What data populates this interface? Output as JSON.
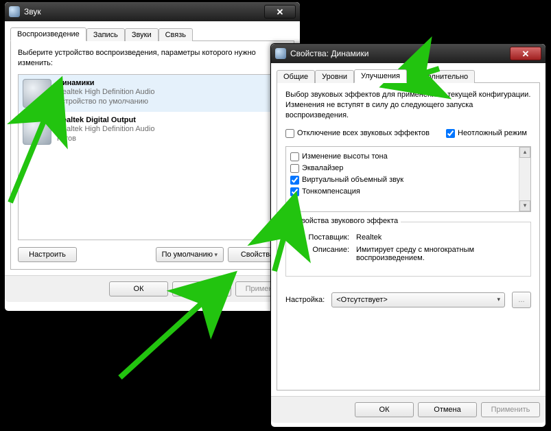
{
  "sound_window": {
    "title": "Звук",
    "tabs": [
      "Воспроизведение",
      "Запись",
      "Звуки",
      "Связь"
    ],
    "active_tab": 0,
    "instruction": "Выберите устройство воспроизведения, параметры которого нужно изменить:",
    "devices": [
      {
        "name": "Динамики",
        "driver": "Realtek High Definition Audio",
        "status": "Устройство по умолчанию",
        "default": true,
        "selected": true
      },
      {
        "name": "Realtek Digital Output",
        "driver": "Realtek High Definition Audio",
        "status": "Готов",
        "default": false,
        "selected": false
      }
    ],
    "buttons": {
      "configure": "Настроить",
      "set_default": "По умолчанию",
      "properties": "Свойства"
    },
    "dialog_buttons": {
      "ok": "ОК",
      "cancel": "Отмена",
      "apply": "Применить"
    }
  },
  "props_window": {
    "title": "Свойства: Динамики",
    "tabs": [
      "Общие",
      "Уровни",
      "Улучшения",
      "Дополнительно"
    ],
    "active_tab": 2,
    "intro": "Выбор звуковых эффектов для применения к текущей конфигурации. Изменения не вступят в силу до следующего запуска воспроизведения.",
    "disable_all": {
      "label": "Отключение всех звуковых эффектов",
      "checked": false
    },
    "urgent_mode": {
      "label": "Неотложный режим",
      "checked": true
    },
    "effects": [
      {
        "label": "Изменение высоты тона",
        "checked": false
      },
      {
        "label": "Эквалайзер",
        "checked": false
      },
      {
        "label": "Виртуальный объемный звук",
        "checked": true
      },
      {
        "label": "Тонкомпенсация",
        "checked": true
      }
    ],
    "groupbox": {
      "legend": "Свойства звукового эффекта",
      "provider_label": "Поставщик:",
      "provider_value": "Realtek",
      "description_label": "Описание:",
      "description_value": "Имитирует среду с многократным воспроизведением."
    },
    "setting_label": "Настройка:",
    "setting_value": "<Отсутствует>",
    "dots": "...",
    "dialog_buttons": {
      "ok": "ОК",
      "cancel": "Отмена",
      "apply": "Применить"
    }
  }
}
